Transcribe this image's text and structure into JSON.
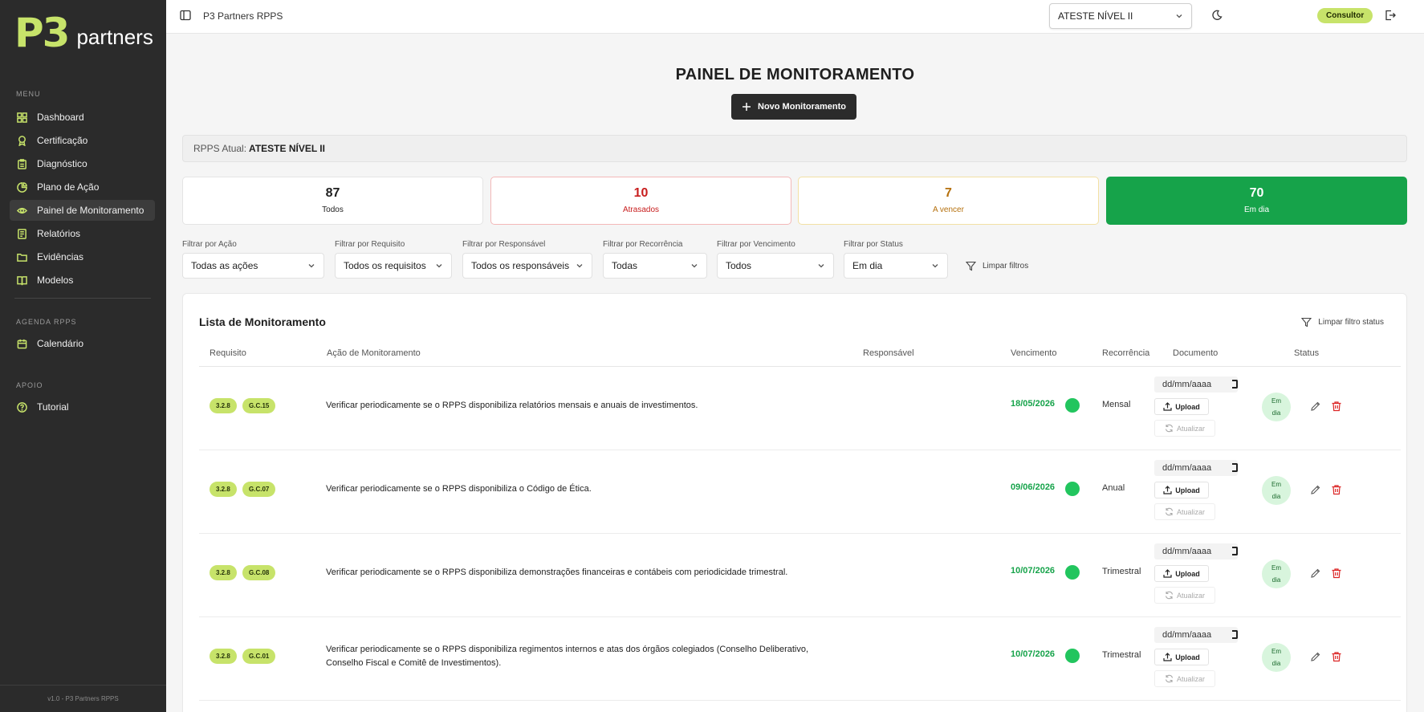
{
  "brand": {
    "mark": "P3",
    "name": "partners",
    "accent": "#c7e36a"
  },
  "sidebar": {
    "menu_heading": "MENU",
    "items": [
      {
        "label": "Dashboard",
        "icon": "grid-icon"
      },
      {
        "label": "Certificação",
        "icon": "award-icon"
      },
      {
        "label": "Diagnóstico",
        "icon": "clipboard-icon"
      },
      {
        "label": "Plano de Ação",
        "icon": "chart-icon"
      },
      {
        "label": "Painel de Monitoramento",
        "icon": "eye-icon",
        "active": true
      },
      {
        "label": "Relatórios",
        "icon": "report-icon"
      },
      {
        "label": "Evidências",
        "icon": "folder-icon"
      },
      {
        "label": "Modelos",
        "icon": "book-icon"
      }
    ],
    "agenda_heading": "AGENDA RPPS",
    "agenda_items": [
      {
        "label": "Calendário",
        "icon": "calendar-icon"
      }
    ],
    "support_heading": "APOIO",
    "support_items": [
      {
        "label": "Tutorial",
        "icon": "help-circle-icon"
      }
    ],
    "footer": "v1.0 - P3 Partners RPPS"
  },
  "topbar": {
    "app_name": "P3 Partners RPPS",
    "rpps_selected": "ATESTE NÍVEL II",
    "role": "Consultor"
  },
  "page": {
    "title": "PAINEL DE MONITORAMENTO",
    "new_button": "Novo Monitoramento",
    "rpps_label": "RPPS Atual:",
    "rpps_value": "ATESTE NÍVEL II"
  },
  "stats": [
    {
      "value": "87",
      "label": "Todos",
      "kind": "all"
    },
    {
      "value": "10",
      "label": "Atrasados",
      "kind": "late",
      "color": "#c81e1e"
    },
    {
      "value": "7",
      "label": "A vencer",
      "kind": "due",
      "color": "#b5700d"
    },
    {
      "value": "70",
      "label": "Em dia",
      "kind": "ok",
      "color": "#16a34a"
    }
  ],
  "filters": [
    {
      "label": "Filtrar por Ação",
      "value": "Todas as ações"
    },
    {
      "label": "Filtrar por Requisito",
      "value": "Todos os requisitos"
    },
    {
      "label": "Filtrar por Responsável",
      "value": "Todos os responsáveis"
    },
    {
      "label": "Filtrar por Recorrência",
      "value": "Todas"
    },
    {
      "label": "Filtrar por Vencimento",
      "value": "Todos"
    },
    {
      "label": "Filtrar por Status",
      "value": "Em dia"
    }
  ],
  "clear_filters": "Limpar filtros",
  "list": {
    "title": "Lista de Monitoramento",
    "clear_status": "Limpar filtro status",
    "columns": [
      "Requisito",
      "Ação de Monitoramento",
      "Responsável",
      "Vencimento",
      "Recorrência",
      "Documento",
      "Status"
    ],
    "rows": [
      {
        "tags": [
          "3.2.8",
          "G.C.15"
        ],
        "action": "Verificar periodicamente se o RPPS disponibiliza relatórios mensais e anuais de investimentos.",
        "responsible": "",
        "due": "18/05/2026",
        "recurrence": "Mensal",
        "date_placeholder": "dd/mm/aaaa",
        "upload": "Upload",
        "refresh": "Atualizar",
        "status": "Em dia"
      },
      {
        "tags": [
          "3.2.8",
          "G.C.07"
        ],
        "action": "Verificar periodicamente se o RPPS disponibiliza o Código de Ética.",
        "responsible": "",
        "due": "09/06/2026",
        "recurrence": "Anual",
        "date_placeholder": "dd/mm/aaaa",
        "upload": "Upload",
        "refresh": "Atualizar",
        "status": "Em dia"
      },
      {
        "tags": [
          "3.2.8",
          "G.C.08"
        ],
        "action": "Verificar periodicamente se o RPPS disponibiliza demonstrações financeiras e contábeis com periodicidade trimestral.",
        "responsible": "",
        "due": "10/07/2026",
        "recurrence": "Trimestral",
        "date_placeholder": "dd/mm/aaaa",
        "upload": "Upload",
        "refresh": "Atualizar",
        "status": "Em dia"
      },
      {
        "tags": [
          "3.2.8",
          "G.C.01"
        ],
        "action": "Verificar periodicamente se o RPPS disponibiliza regimentos internos e atas dos órgãos colegiados (Conselho Deliberativo, Conselho Fiscal e Comitê de Investimentos).",
        "responsible": "",
        "due": "10/07/2026",
        "recurrence": "Trimestral",
        "date_placeholder": "dd/mm/aaaa",
        "upload": "Upload",
        "refresh": "Atualizar",
        "status": "Em dia"
      }
    ]
  }
}
